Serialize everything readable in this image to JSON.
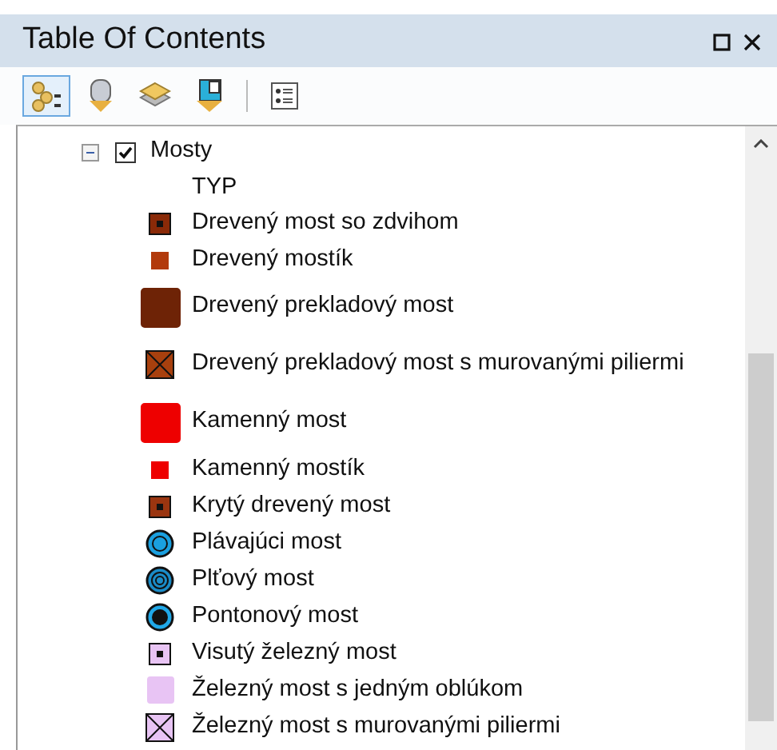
{
  "window": {
    "title": "Table Of Contents"
  },
  "toolbar": [
    {
      "selected": true
    },
    {
      "selected": false
    },
    {
      "selected": false
    },
    {
      "selected": false
    },
    {
      "selected": false
    }
  ],
  "layer": {
    "name": "Mosty",
    "expanded": true,
    "checked": true,
    "field": "TYP",
    "legend": [
      {
        "label": "Drevený most so zdvihom",
        "kind": "square-dot",
        "color": "#8a2a08"
      },
      {
        "label": "Drevený mostík",
        "kind": "square",
        "color": "#b23a0c"
      },
      {
        "label": "Drevený prekladový most",
        "kind": "square-large",
        "color": "#6e2306"
      },
      {
        "label": "Drevený prekladový most s murovanými piliermi",
        "kind": "square-cross",
        "color": "#a8400e"
      },
      {
        "label": "Kamenný most",
        "kind": "square-large",
        "color": "#ee0000"
      },
      {
        "label": "Kamenný mostík",
        "kind": "square",
        "color": "#ee0000"
      },
      {
        "label": "Krytý drevený most",
        "kind": "square-dot",
        "color": "#9a3510"
      },
      {
        "label": "Plávajúci most",
        "kind": "ring",
        "color": "#1aa0e0"
      },
      {
        "label": "Plťový most",
        "kind": "double-ring",
        "color": "#1a8cc8"
      },
      {
        "label": "Pontonový most",
        "kind": "dot-ring",
        "color": "#20a8e8"
      },
      {
        "label": "Visutý železný most",
        "kind": "square-dot",
        "color": "#e8c4f4"
      },
      {
        "label": "Železný most s jedným oblúkom",
        "kind": "square-plain",
        "color": "#e8c4f4"
      },
      {
        "label": "Železný most s murovanými piliermi",
        "kind": "square-cross-small",
        "color": "#e8c4f4"
      }
    ]
  }
}
